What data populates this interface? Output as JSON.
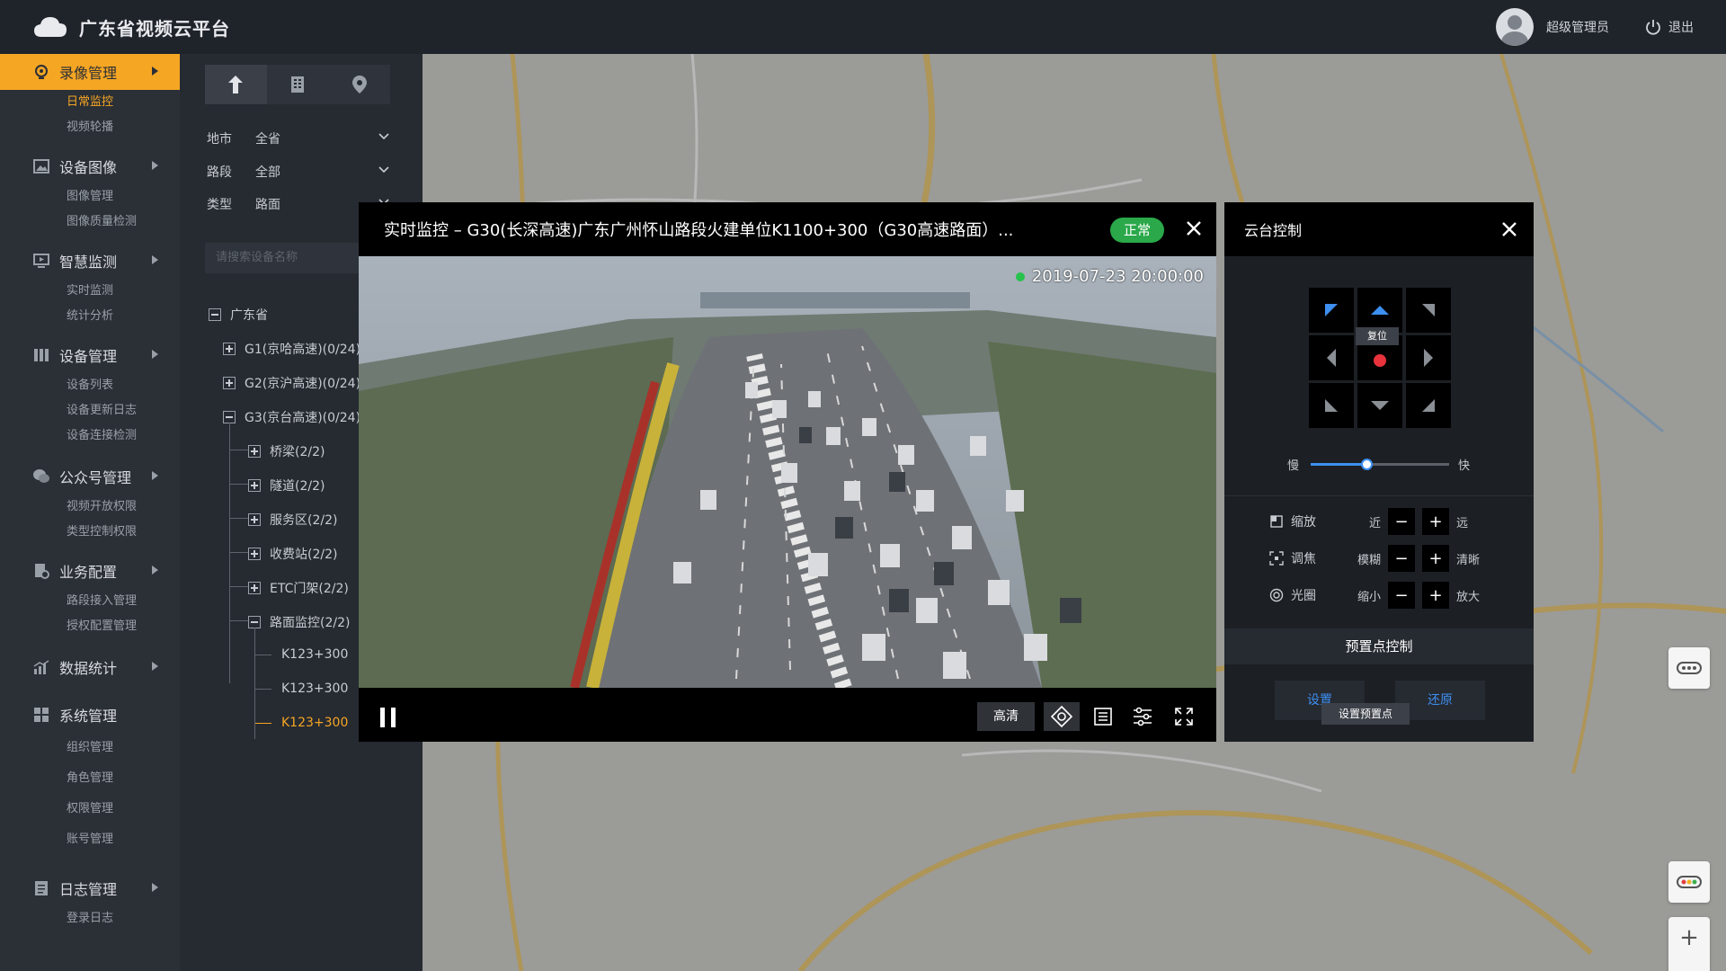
{
  "app": {
    "title": "广东省视频云平台"
  },
  "user": {
    "name": "超级管理员",
    "logout": "退出"
  },
  "sidebar": {
    "groups": [
      {
        "label": "录像管理",
        "items": [
          "日常监控",
          "视频轮播"
        ]
      },
      {
        "label": "设备图像",
        "items": [
          "图像管理",
          "图像质量检测"
        ]
      },
      {
        "label": "智慧监测",
        "items": [
          "实时监测",
          "统计分析"
        ]
      },
      {
        "label": "设备管理",
        "items": [
          "设备列表",
          "设备更新日志",
          "设备连接检测"
        ]
      },
      {
        "label": "公众号管理",
        "items": [
          "视频开放权限",
          "类型控制权限"
        ]
      },
      {
        "label": "业务配置",
        "items": [
          "路段接入管理",
          "授权配置管理"
        ]
      },
      {
        "label": "数据统计",
        "items": []
      },
      {
        "label": "系统管理",
        "items": [
          "组织管理",
          "角色管理",
          "权限管理",
          "账号管理"
        ]
      },
      {
        "label": "日志管理",
        "items": [
          "登录日志"
        ]
      }
    ]
  },
  "filters": [
    {
      "label": "地市",
      "value": "全省"
    },
    {
      "label": "路段",
      "value": "全部"
    },
    {
      "label": "类型",
      "value": "路面"
    }
  ],
  "search": {
    "placeholder": "请搜索设备名称"
  },
  "tree": {
    "root": "广东省",
    "roads": [
      "G1(京哈高速)(0/24)",
      "G2(京沪高速)(0/24)",
      "G3(京台高速)(0/24)"
    ],
    "children": [
      "桥梁(2/2)",
      "隧道(2/2)",
      "服务区(2/2)",
      "收费站(2/2)",
      "ETC门架(2/2)",
      "路面监控(2/2)"
    ],
    "leaves": [
      "K123+300",
      "K123+300",
      "K123+300"
    ]
  },
  "video": {
    "title": "实时监控 – G30(长深高速)广东广州怀山路段火建单位K1100+300（G30高速路面）...",
    "status": "正常",
    "timestamp": "2019-07-23 20:00:00",
    "quality": "高清"
  },
  "ptz": {
    "title": "云台控制",
    "reset": "复位",
    "speed": {
      "slow": "慢",
      "fast": "快",
      "value": 0.4
    },
    "lens": [
      {
        "name": "缩放",
        "low": "近",
        "high": "远"
      },
      {
        "name": "调焦",
        "low": "模糊",
        "high": "清晰"
      },
      {
        "name": "光圈",
        "low": "缩小",
        "high": "放大"
      }
    ],
    "preset": {
      "title": "预置点控制",
      "set": "设置",
      "restore": "还原",
      "tooltip": "设置预置点"
    }
  },
  "colors": {
    "accent": "#f5a623",
    "status_ok": "#2aa84a",
    "link": "#3d8ff0"
  }
}
